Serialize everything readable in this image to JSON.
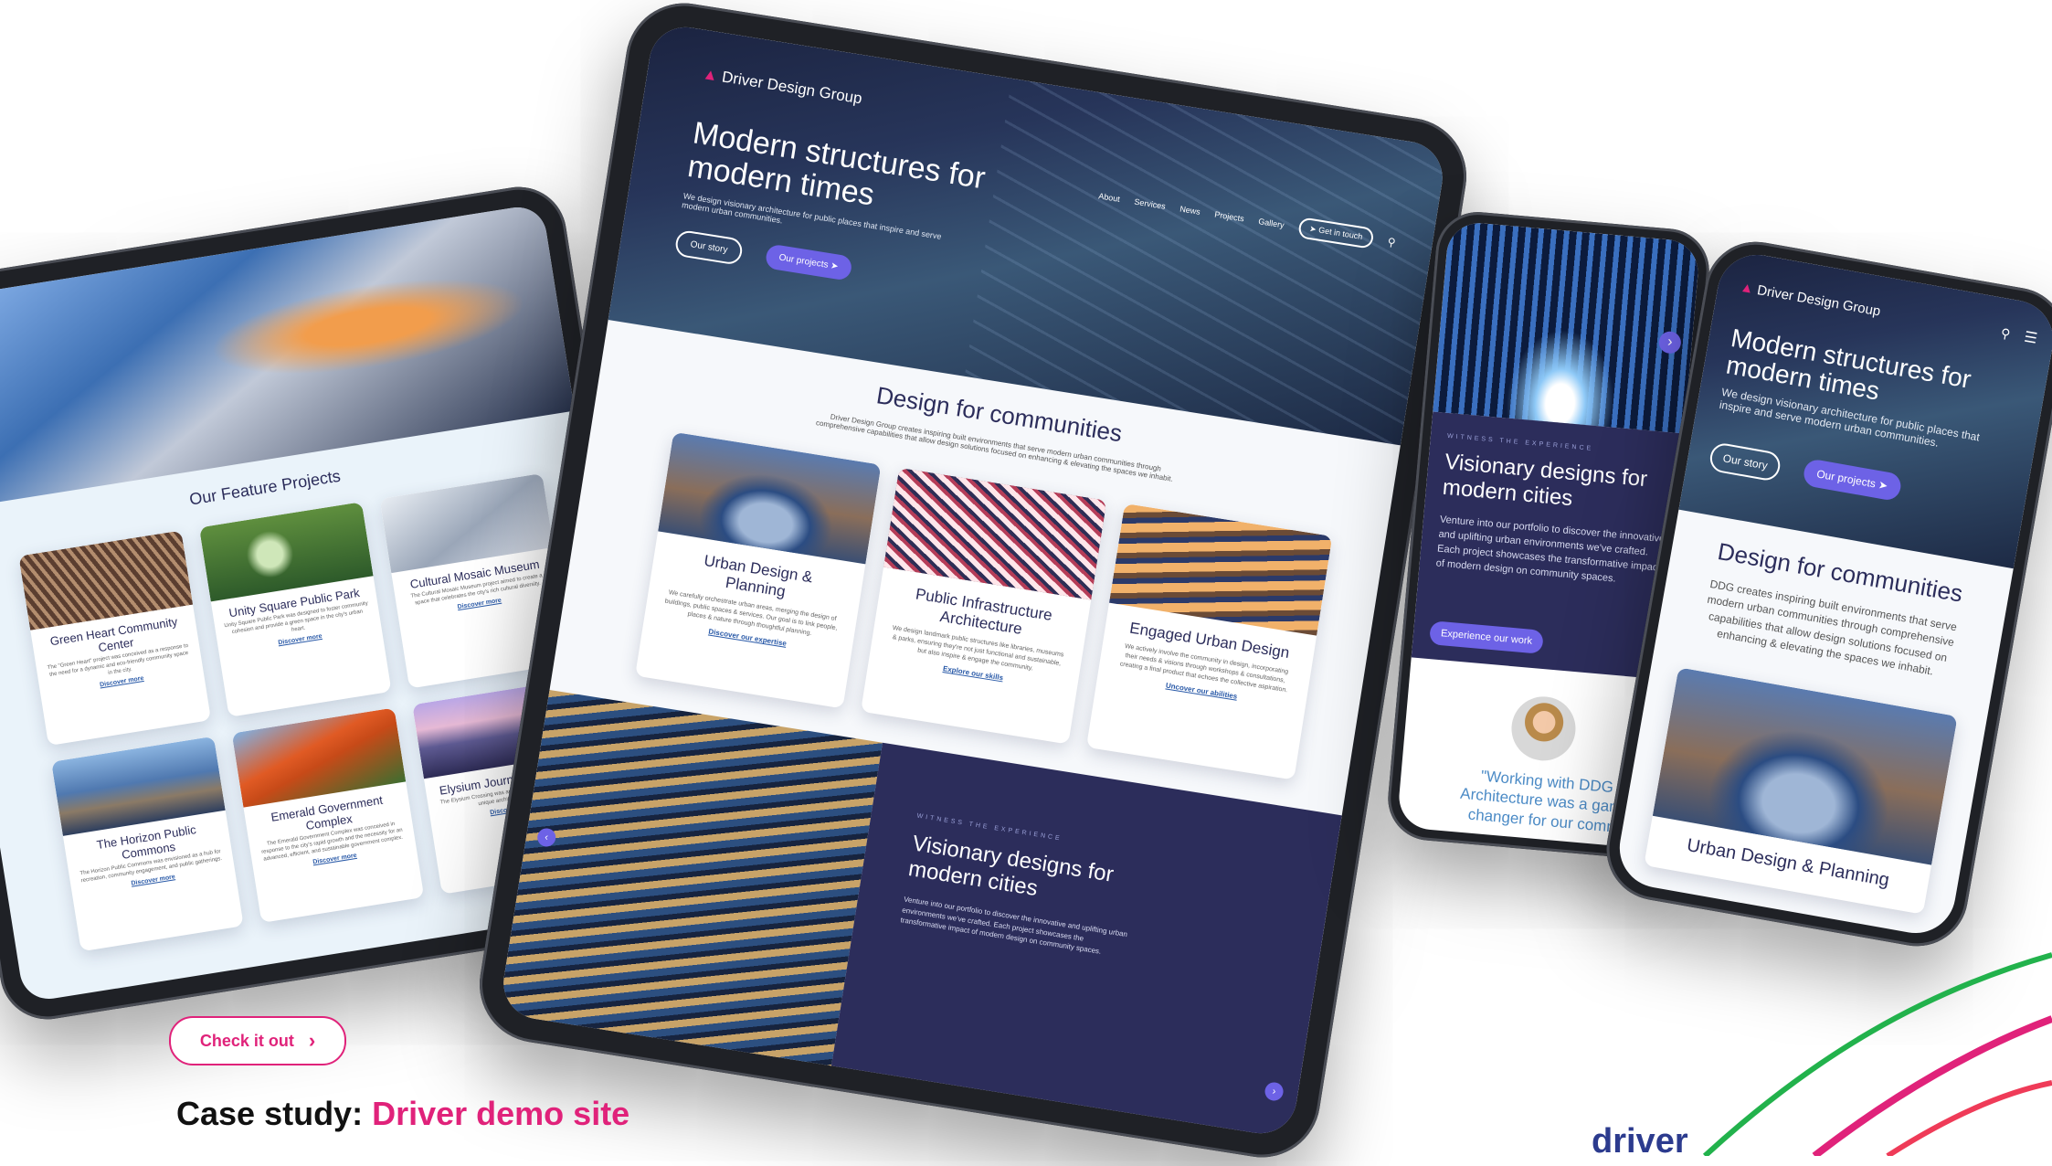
{
  "brand": {
    "name": "Driver Design Group",
    "accent": "#e0227a",
    "navy": "#2c2d5b",
    "purple": "#6d62e6"
  },
  "cta": {
    "label": "Check it out",
    "icon": "chevron-right-icon"
  },
  "case_study": {
    "prefix": "Case study:",
    "highlight": "Driver demo site",
    "footer_logo": "driver"
  },
  "left_tablet": {
    "section_title": "Our Feature Projects",
    "projects": [
      {
        "title": "Green Heart Community Center",
        "desc": "The \"Green Heart\" project was conceived as a response to the need for a dynamic and eco-friendly community space in the city.",
        "link": "Discover more"
      },
      {
        "title": "Unity Square Public Park",
        "desc": "Unity Square Public Park was designed to foster community cohesion and provide a green space in the city's urban heart.",
        "link": "Discover more"
      },
      {
        "title": "Cultural Mosaic Museum",
        "desc": "The Cultural Mosaic Museum project aimed to create a space that celebrates the city's rich cultural diversity.",
        "link": "Discover more"
      },
      {
        "title": "The Horizon Public Commons",
        "desc": "The Horizon Public Commons was envisioned as a hub for recreation, community engagement, and public gatherings.",
        "link": "Discover more"
      },
      {
        "title": "Emerald Government Complex",
        "desc": "The Emerald Government Complex was conceived in response to the city's rapid growth and the necessity for an advanced, efficient, and sustainable government complex.",
        "link": "Discover more"
      },
      {
        "title": "Elysium Journey Crossing",
        "desc": "The Elysium Crossing was an infrastructure project with a unique architectural vision.",
        "link": "Discover more"
      }
    ]
  },
  "center_tablet": {
    "logo": "Driver Design Group",
    "nav": [
      "About",
      "Services",
      "News",
      "Projects",
      "Gallery"
    ],
    "get_in_touch": "Get in touch",
    "hero_title": "Modern structures for modern times",
    "hero_sub": "We design visionary architecture for public places that inspire and serve modern urban communities.",
    "btn_story": "Our story",
    "btn_projects": "Our projects",
    "communities_title": "Design for communities",
    "communities_sub": "Driver Design Group creates inspiring built environments that serve modern urban communities through comprehensive capabilities that allow design solutions focused on enhancing & elevating the spaces we inhabit.",
    "services": [
      {
        "title": "Urban Design & Planning",
        "desc": "We carefully orchestrate urban areas, merging the design of buildings, public spaces & services. Our goal is to link people, places & nature through thoughtful planning.",
        "link": "Discover our expertise"
      },
      {
        "title": "Public Infrastructure Architecture",
        "desc": "We design landmark public structures like libraries, museums & parks, ensuring they're not just functional and sustainable, but also inspire & engage the community.",
        "link": "Explore our skills"
      },
      {
        "title": "Engaged Urban Design",
        "desc": "We actively involve the community in design, incorporating their needs & visions through workshops & consultations, creating a final product that echoes the collective aspiration.",
        "link": "Uncover our abilities"
      }
    ],
    "witness_kicker": "WITNESS THE EXPERIENCE",
    "witness_title": "Visionary designs for modern cities",
    "witness_body": "Venture into our portfolio to discover the innovative and uplifting urban environments we've crafted. Each project showcases the transformative impact of modern design on community spaces."
  },
  "right_phone_1": {
    "kicker": "WITNESS THE EXPERIENCE",
    "title": "Visionary designs for modern cities",
    "body": "Venture into our portfolio to discover the innovative and uplifting urban environments we've crafted. Each project showcases the transformative impact of modern design on community spaces.",
    "button": "Experience our work",
    "quote": "\"Working with DDG Architecture was a game changer for our comm"
  },
  "right_phone_2": {
    "logo": "Driver Design Group",
    "hero_title": "Modern structures for modern times",
    "hero_sub": "We design visionary architecture for public places that inspire and serve modern urban communities.",
    "btn_story": "Our story",
    "btn_projects": "Our projects",
    "communities_title": "Design for communities",
    "communities_sub": "DDG creates inspiring built environments that serve modern urban communities through comprehensive capabilities that allow design solutions focused on enhancing & elevating the spaces we inhabit.",
    "card_title": "Urban Design & Planning"
  }
}
